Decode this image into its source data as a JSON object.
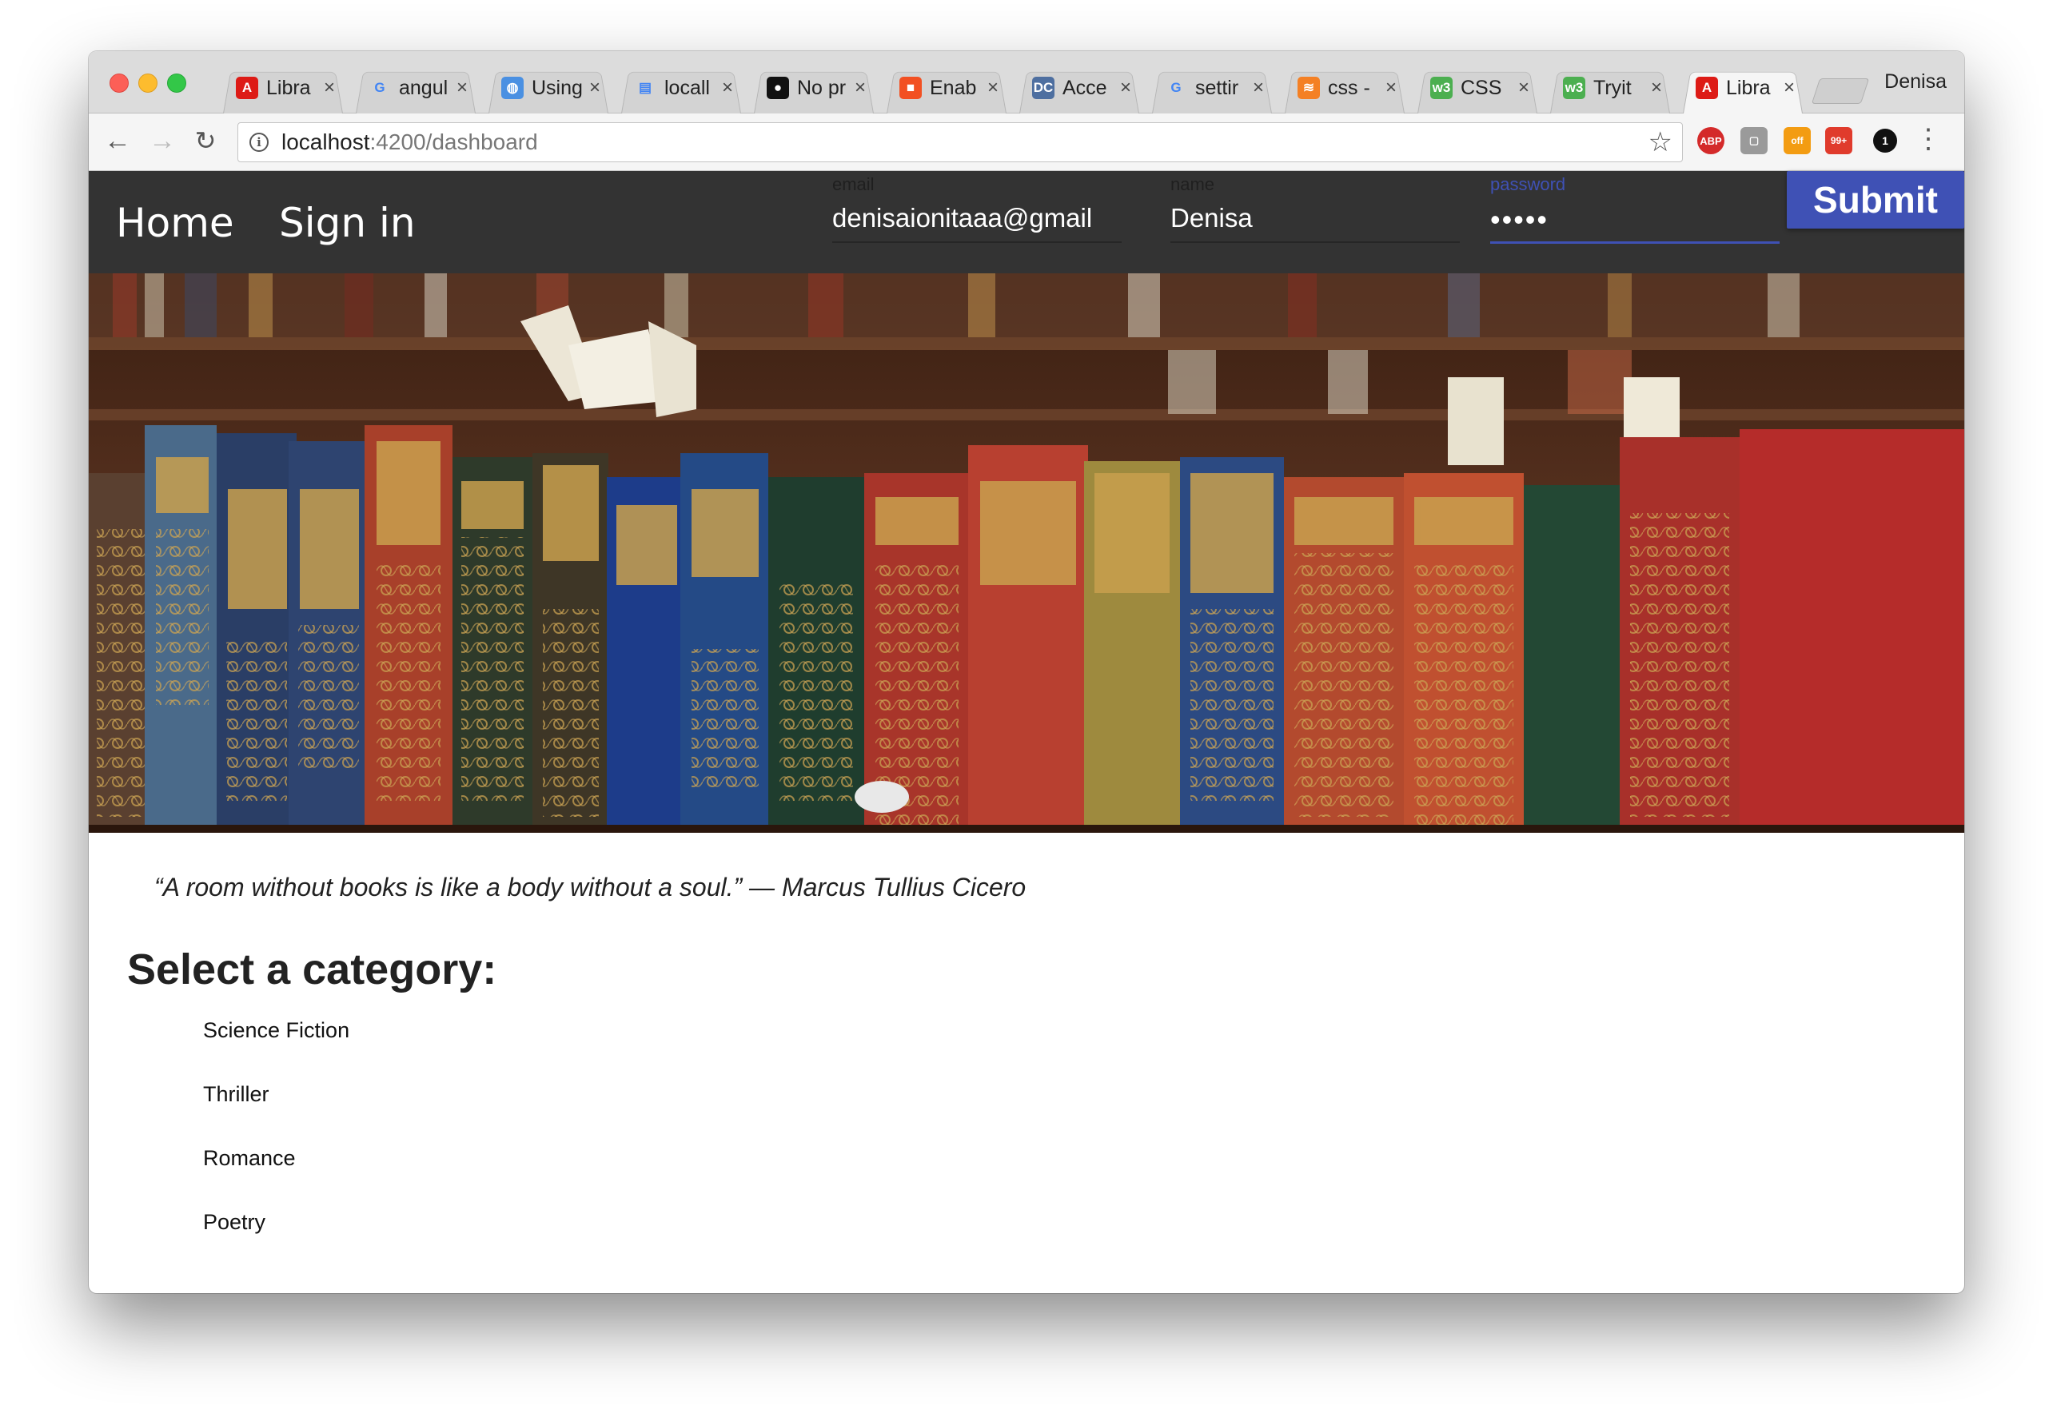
{
  "browser": {
    "tabs": [
      {
        "title": "Libra",
        "icon": "angular-icon",
        "color": "#dd1b16",
        "glyph": "A"
      },
      {
        "title": "angul",
        "icon": "google-icon",
        "color": "#ffffff",
        "glyph": "G"
      },
      {
        "title": "Using",
        "icon": "globe-icon",
        "color": "#4a90e2",
        "glyph": "◍"
      },
      {
        "title": "locall",
        "icon": "document-icon",
        "color": "#ffffff",
        "glyph": "▤"
      },
      {
        "title": "No pr",
        "icon": "github-icon",
        "color": "#111111",
        "glyph": "●"
      },
      {
        "title": "Enab",
        "icon": "microsoft-icon",
        "color": "#f25022",
        "glyph": "■"
      },
      {
        "title": "Acce",
        "icon": "dc-icon",
        "color": "#4e6fa0",
        "glyph": "DC"
      },
      {
        "title": "settir",
        "icon": "google-icon",
        "color": "#ffffff",
        "glyph": "G"
      },
      {
        "title": "css -",
        "icon": "stackoverflow-icon",
        "color": "#f48024",
        "glyph": "≋"
      },
      {
        "title": "CSS",
        "icon": "w3schools-icon",
        "color": "#4caf50",
        "glyph": "w3"
      },
      {
        "title": "Tryit",
        "icon": "w3schools-icon",
        "color": "#4caf50",
        "glyph": "w3"
      },
      {
        "title": "Libra",
        "icon": "angular-icon",
        "color": "#dd1b16",
        "glyph": "A",
        "active": true
      }
    ],
    "close_glyph": "×",
    "profile_name": "Denisa",
    "url_host": "localhost",
    "url_path": ":4200/dashboard",
    "extensions": {
      "abp": "ABP",
      "off": "off",
      "badge": "99+",
      "one": "1"
    }
  },
  "header": {
    "nav": {
      "home": "Home",
      "signin": "Sign in"
    },
    "fields": {
      "email": {
        "label": "email",
        "value": "denisaionitaaa@gmail"
      },
      "name": {
        "label": "name",
        "value": "Denisa"
      },
      "password": {
        "label": "password",
        "value": "•••••"
      }
    },
    "submit_label": "Submit",
    "accent_color": "#3f51b5",
    "bar_color": "#333333"
  },
  "content": {
    "quote": "“A room without books is like a body without a soul.” — Marcus Tullius Cicero",
    "section_title": "Select a category:",
    "categories": [
      "Science Fiction",
      "Thriller",
      "Romance",
      "Poetry"
    ]
  }
}
